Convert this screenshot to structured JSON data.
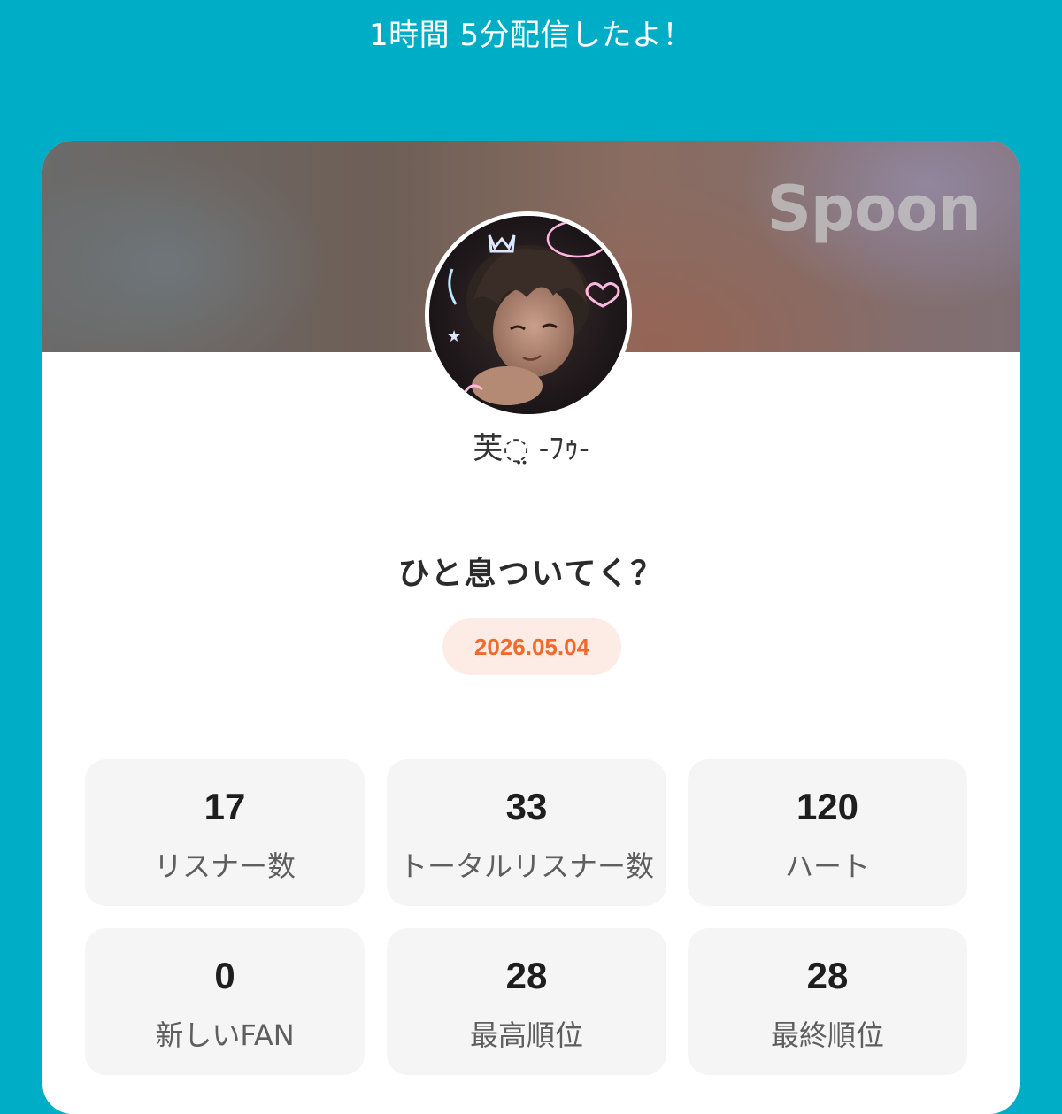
{
  "banner": {
    "text": "1時間 5分配信したよ！"
  },
  "card": {
    "brand_logo": "Spoon",
    "avatar_icon": "dj-avatar",
    "username": "芙◌̤ -ﾌｩ-",
    "live_title": "ひと息ついてく？",
    "date": "2026.05.04"
  },
  "stats": [
    {
      "value": "17",
      "label": "リスナー数"
    },
    {
      "value": "33",
      "label": "トータルリスナー数"
    },
    {
      "value": "120",
      "label": "ハート"
    },
    {
      "value": "0",
      "label": "新しいFAN"
    },
    {
      "value": "28",
      "label": "最高順位"
    },
    {
      "value": "28",
      "label": "最終順位"
    }
  ],
  "colors": {
    "background": "#00adc6",
    "card": "#ffffff",
    "date_text": "#f26a2b",
    "date_pill": "#fdece5",
    "stat_box": "#f5f5f5"
  }
}
